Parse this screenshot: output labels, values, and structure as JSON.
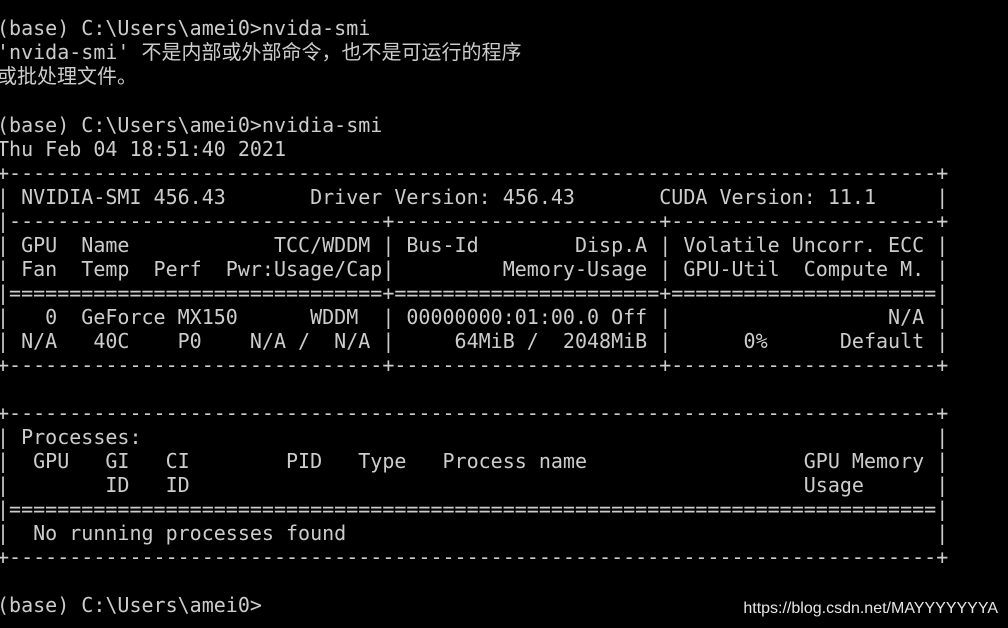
{
  "terminal": {
    "lines": [
      "(base) C:\\Users\\amei0>nvida-smi",
      "'nvida-smi' 不是内部或外部命令，也不是可运行的程序",
      "或批处理文件。",
      "",
      "(base) C:\\Users\\amei0>nvidia-smi",
      "Thu Feb 04 18:51:40 2021",
      "+-----------------------------------------------------------------------------+",
      "| NVIDIA-SMI 456.43       Driver Version: 456.43       CUDA Version: 11.1     |",
      "|-------------------------------+----------------------+----------------------+",
      "| GPU  Name            TCC/WDDM | Bus-Id        Disp.A | Volatile Uncorr. ECC |",
      "| Fan  Temp  Perf  Pwr:Usage/Cap|         Memory-Usage | GPU-Util  Compute M. |",
      "|===============================+======================+======================|",
      "|   0  GeForce MX150      WDDM  | 00000000:01:00.0 Off |                  N/A |",
      "| N/A   40C    P0    N/A /  N/A |     64MiB /  2048MiB |      0%      Default |",
      "+-------------------------------+----------------------+----------------------+",
      "",
      "+-----------------------------------------------------------------------------+",
      "| Processes:                                                                  |",
      "|  GPU   GI   CI        PID   Type   Process name                  GPU Memory |",
      "|        ID   ID                                                   Usage      |",
      "|=============================================================================|",
      "|  No running processes found                                                 |",
      "+-----------------------------------------------------------------------------+",
      "",
      "(base) C:\\Users\\amei0>"
    ]
  },
  "watermark": "https://blog.csdn.net/MAYYYYYYYA",
  "colors": {
    "background": "#000000",
    "foreground": "#cccccc"
  }
}
